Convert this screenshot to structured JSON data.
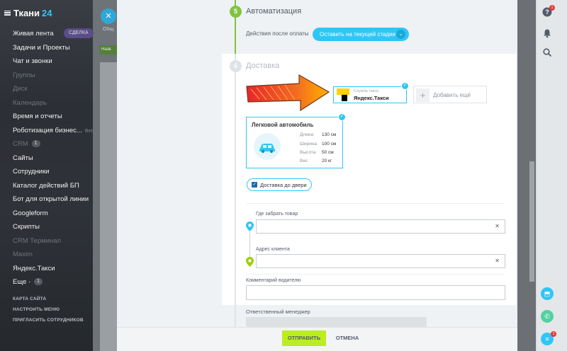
{
  "app": {
    "logo_text": "Ткани",
    "logo_num": "24"
  },
  "left_menu": {
    "items": [
      {
        "label": "Живая лента",
        "dim": false
      },
      {
        "label": "Задачи и Проекты",
        "dim": false
      },
      {
        "label": "Чат и звонки",
        "dim": false
      },
      {
        "label": "Группы",
        "dim": true
      },
      {
        "label": "Диск",
        "dim": true
      },
      {
        "label": "Календарь",
        "dim": true
      },
      {
        "label": "Время и отчеты",
        "dim": false
      },
      {
        "label": "Роботизация бизнес...",
        "dim": false,
        "extra": "Beta"
      },
      {
        "label": "CRM",
        "dim": true,
        "count": "1"
      },
      {
        "label": "Сайты",
        "dim": false
      },
      {
        "label": "Сотрудники",
        "dim": false
      },
      {
        "label": "Каталог действий БП",
        "dim": false
      },
      {
        "label": "Бот для открытой линии",
        "dim": false
      },
      {
        "label": "Googleform",
        "dim": false
      },
      {
        "label": "Скрипты",
        "dim": false
      },
      {
        "label": "CRM Терминал",
        "dim": true
      },
      {
        "label": "Maxim",
        "dim": true
      },
      {
        "label": "Яндекс.Такси",
        "dim": false
      },
      {
        "label": "Еще ·",
        "dim": false,
        "count": "1"
      }
    ],
    "footer": [
      "КАРТА САЙТА",
      "НАСТРОИТЬ МЕНЮ",
      "ПРИГЛАСИТЬ СОТРУДНИКОВ"
    ]
  },
  "background": {
    "deal_tab": "СДЕЛКА",
    "green_btn": "Назв",
    "col": [
      "Общ",
      "",
      "",
      "",
      "",
      "",
      "",
      "",
      "",
      "",
      ""
    ]
  },
  "automation": {
    "step": "5",
    "title": "Автоматизация",
    "label": "Действия после оплаты",
    "stage_button": "Оставить на текущей стадии"
  },
  "delivery": {
    "step": "6",
    "title": "Доставка",
    "service": {
      "label": "Служба такси",
      "name": "Яндекс.Такси"
    },
    "add_more": "Добавить ещё",
    "car": {
      "title": "Легковой автомобиль",
      "specs": [
        {
          "k": "Длина",
          "v": "130 см"
        },
        {
          "k": "Ширина",
          "v": "100 см"
        },
        {
          "k": "Высота",
          "v": "50 см"
        },
        {
          "k": "Вес",
          "v": "20 кг"
        }
      ]
    },
    "door_delivery": "Доставка до двери",
    "pickup_label": "Где забрать товар",
    "pickup_value": "",
    "address_label": "Адрес клиента",
    "address_value": "",
    "comment_label": "Комментарий водителю",
    "comment_value": "",
    "manager_label": "Ответственный менеджер"
  },
  "footer": {
    "send": "ОТПРАВИТЬ",
    "cancel": "ОТМЕНА"
  },
  "right_rail": {
    "help_badge": "1",
    "chat_badge": "1"
  },
  "colors": {
    "accent": "#2fc6f6",
    "step_green": "#82c341",
    "send_green": "#bbed21",
    "yandex_yellow": "#ffd200"
  }
}
